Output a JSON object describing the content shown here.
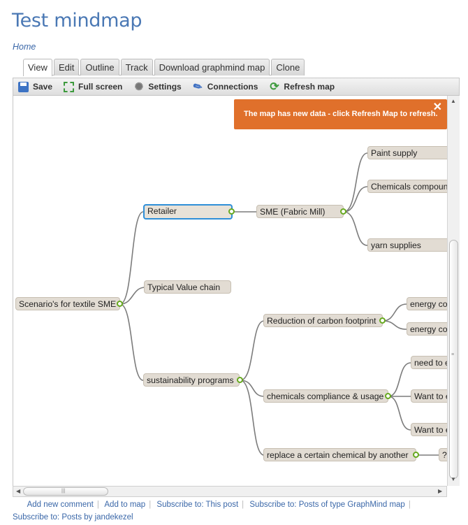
{
  "page": {
    "title": "Test mindmap",
    "breadcrumb": "Home"
  },
  "tabs": [
    "View",
    "Edit",
    "Outline",
    "Track",
    "Download graphmind map",
    "Clone"
  ],
  "toolbar": {
    "save": "Save",
    "fullscreen": "Full screen",
    "settings": "Settings",
    "connections": "Connections",
    "refresh": "Refresh map"
  },
  "notice": {
    "text": "The map has new data - click Refresh Map to refresh.",
    "close": "✕"
  },
  "mindmap": {
    "root": "Scenario's for textile SME",
    "retailer": "Retailer",
    "typical_value_chain": "Typical Value chain",
    "sustainability_programs": "sustainability programs",
    "sme_fabric_mill": "SME (Fabric Mill)",
    "paint_supply": "Paint supply",
    "chemicals_compound": "Chemicals compound",
    "yarn_supplies": "yarn supplies",
    "reduction_carbon": "Reduction of carbon footprint",
    "chemicals_compliance": "chemicals compliance & usage",
    "replace_chemical": "replace a certain chemical by another",
    "energy_1": "energy con",
    "energy_2": "energy con",
    "need_to": "need to e",
    "want_to_1": "Want to e",
    "want_to_2": "Want to e",
    "question": "?"
  },
  "footer_links": [
    "Add new comment",
    "Add to map",
    "Subscribe to: This post",
    "Subscribe to: Posts of type GraphMind map",
    "Subscribe to: Posts by jandekezel"
  ],
  "colors": {
    "accent": "#4a78b4",
    "notice": "#e0702b",
    "node": "#e2dcd3",
    "knob": "#66a91e",
    "selected": "#2f8fd8"
  }
}
